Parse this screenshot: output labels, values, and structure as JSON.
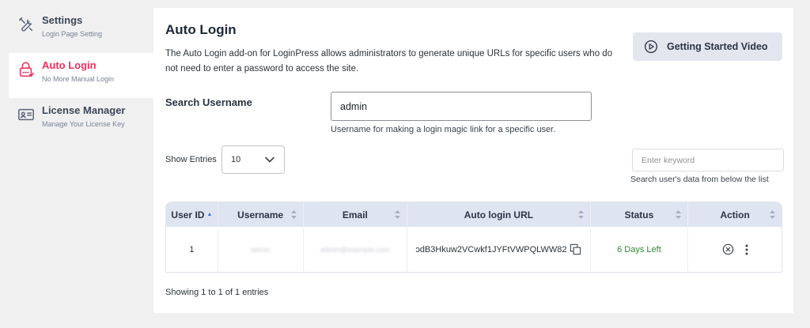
{
  "sidebar": {
    "items": [
      {
        "title": "Settings",
        "subtitle": "Login Page Setting",
        "icon": "wrench-screwdriver-icon"
      },
      {
        "title": "Auto Login",
        "subtitle": "No More Manual Login",
        "icon": "lock-icon",
        "active": true
      },
      {
        "title": "License Manager",
        "subtitle": "Manage Your License Key",
        "icon": "id-card-icon"
      }
    ]
  },
  "main": {
    "title": "Auto Login",
    "description": "The Auto Login add-on for LoginPress allows administrators to generate unique URLs for specific users who do not need to enter a password to access the site.",
    "video_button_label": "Getting Started Video",
    "search": {
      "label": "Search Username",
      "value": "admin",
      "help": "Username for making a login magic link for a specific user."
    },
    "entries": {
      "label": "Show Entries",
      "value": "10"
    },
    "keyword": {
      "placeholder": "Enter keyword",
      "help": "Search user's data from below the list"
    },
    "table": {
      "headers": [
        "User ID",
        "Username",
        "Email",
        "Auto login URL",
        "Status",
        "Action"
      ],
      "rows": [
        {
          "user_id": "1",
          "username": "admin",
          "email": "admin@example.com",
          "url": "ɔdB3Hkuw2VCwkf1JYFtVWPQLWW82",
          "status": "6 Days Left"
        }
      ]
    },
    "showing_text": "Showing 1 to 1 of 1 entries"
  },
  "colors": {
    "accent": "#e8335e",
    "status_green": "#2e8b2e",
    "table_header": "#dfe4f1",
    "sort_active": "#3b6fd9"
  }
}
